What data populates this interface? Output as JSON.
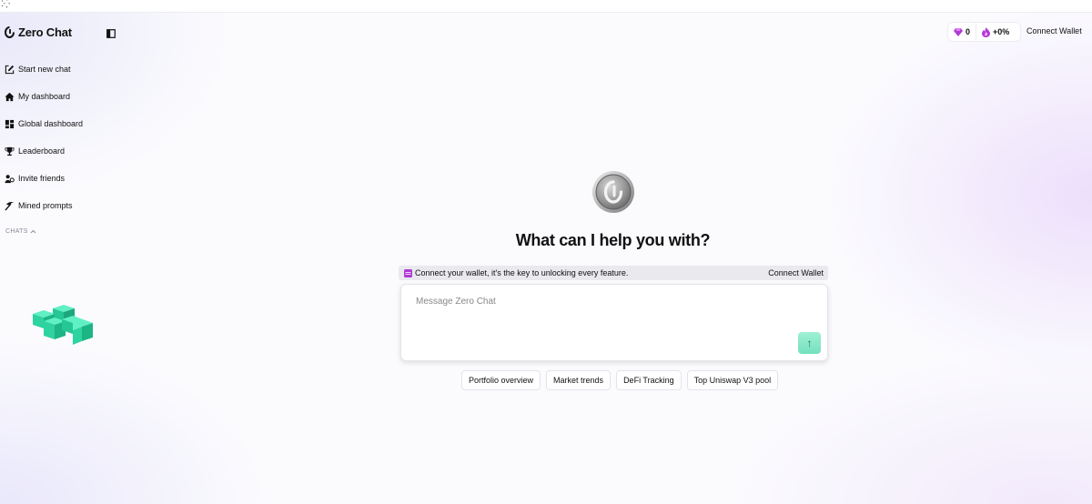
{
  "topstrip": {
    "glyph": "⁚⁛"
  },
  "brand": {
    "name": "Zero Chat"
  },
  "sidebar": {
    "items": [
      {
        "label": "Start new chat",
        "icon": "edit-icon"
      },
      {
        "label": "My dashboard",
        "icon": "home-icon"
      },
      {
        "label": "Global dashboard",
        "icon": "grid-icon"
      },
      {
        "label": "Leaderboard",
        "icon": "trophy-icon"
      },
      {
        "label": "Invite friends",
        "icon": "people-icon"
      },
      {
        "label": "Mined prompts",
        "icon": "pickaxe-icon"
      }
    ],
    "chats_label": "CHATS"
  },
  "header": {
    "gems": "0",
    "boost": "+0%",
    "connect_wallet": "Connect Wallet"
  },
  "main": {
    "headline": "What can I help you with?",
    "banner_text": "Connect your wallet, it's the key to unlocking every feature.",
    "banner_connect": "Connect Wallet",
    "message_placeholder": "Message Zero Chat",
    "send_symbol": "↑",
    "suggestions": [
      "Portfolio overview",
      "Market trends",
      "DeFi Tracking",
      "Top Uniswap V3 pool"
    ]
  },
  "colors": {
    "accent_mint": "#74e0bf",
    "accent_purple": "#b23ad6",
    "cube_green": "#2ed3a0"
  }
}
